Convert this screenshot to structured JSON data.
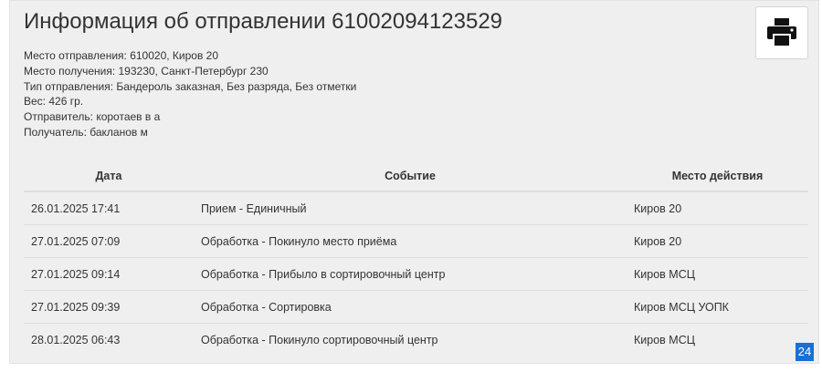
{
  "shipment": {
    "title": "Информация об отправлении 61002094123529",
    "details": [
      "Место отправления: 610020, Киров 20",
      "Место получения: 193230, Санкт-Петербург 230",
      "Тип отправления: Бандероль заказная, Без разряда, Без отметки",
      "Вес: 426 гр.",
      "Отправитель: коротаев в а",
      "Получатель: бакланов м"
    ]
  },
  "toolbar": {
    "print_icon": "print-icon"
  },
  "table": {
    "headers": [
      "Дата",
      "Событие",
      "Место действия"
    ],
    "rows": [
      [
        "26.01.2025 17:41",
        "Прием - Единичный",
        "Киров 20"
      ],
      [
        "27.01.2025 07:09",
        "Обработка - Покинуло место приёма",
        "Киров 20"
      ],
      [
        "27.01.2025 09:14",
        "Обработка - Прибыло в сортировочный центр",
        "Киров МСЦ"
      ],
      [
        "27.01.2025 09:39",
        "Обработка - Сортировка",
        "Киров МСЦ УОПК"
      ],
      [
        "28.01.2025 06:43",
        "Обработка - Покинуло сортировочный центр",
        "Киров МСЦ"
      ]
    ]
  },
  "badge": {
    "text": "24"
  },
  "colors": {
    "panel_bg": "#efefef",
    "badge_bg": "#1a6fd6"
  }
}
